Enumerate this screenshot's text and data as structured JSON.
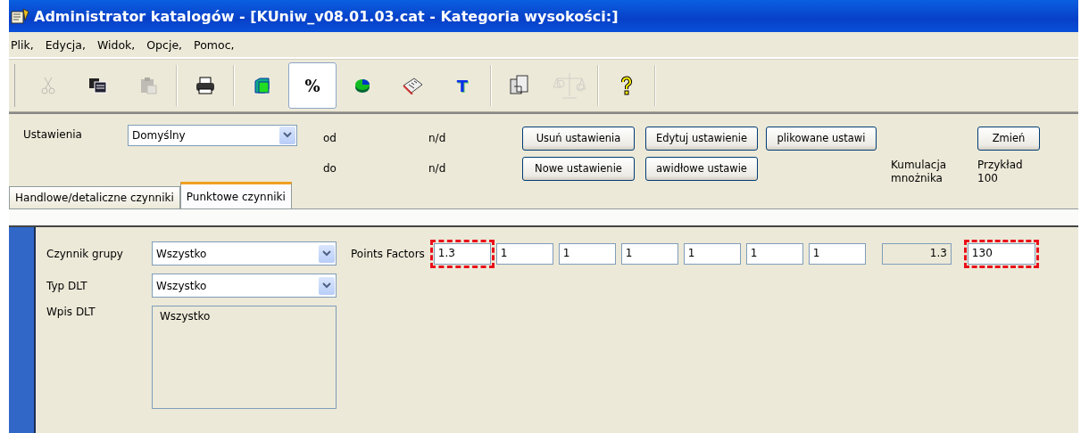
{
  "window": {
    "title": "Administrator katalogów - [KUniw_v08.01.03.cat - Kategoria wysokości:]"
  },
  "menu": [
    "Plik,",
    "Edycja,",
    "Widok,",
    "Opcje,",
    "Pomoc,"
  ],
  "toolbar": [
    [
      {
        "disabled": true,
        "selected": false
      },
      {
        "disabled": false,
        "selected": false
      },
      {
        "disabled": true,
        "selected": false
      }
    ],
    [
      {
        "disabled": false,
        "selected": false
      }
    ],
    [
      {
        "disabled": false,
        "selected": false
      },
      {
        "disabled": false,
        "selected": true,
        "label": "%"
      },
      {
        "disabled": false,
        "selected": false
      },
      {
        "disabled": false,
        "selected": false
      },
      {
        "disabled": false,
        "selected": false,
        "label": "T"
      }
    ],
    [
      {
        "disabled": false,
        "selected": false
      },
      {
        "disabled": true,
        "selected": false
      }
    ],
    [
      {
        "disabled": false,
        "selected": false
      }
    ]
  ],
  "settings": {
    "label": "Ustawienia",
    "value": "Domyślny",
    "from_label": "od",
    "from_value": "n/d",
    "to_label": "do",
    "to_value": "n/d",
    "buttons_row1": [
      "Usuń ustawienia",
      "Edytuj ustawienie",
      "plikowane ustawi"
    ],
    "buttons_row2": [
      "Nowe ustawienie",
      "awidłowe ustawie"
    ],
    "change_button": "Zmień",
    "cumulation_label": "Kumulacja mnożnika",
    "example_label": "Przykład",
    "example_value": "100"
  },
  "tabs": [
    {
      "label": "Handlowe/detaliczne czynniki",
      "selected": false
    },
    {
      "label": "Punktowe czynniki",
      "selected": true
    }
  ],
  "filters": [
    {
      "label": "Czynnik grupy",
      "value": "Wszystko"
    },
    {
      "label": "Typ DLT",
      "value": "Wszystko"
    }
  ],
  "dlt_entry": {
    "label": "Wpis DLT",
    "items": [
      "Wszystko"
    ],
    "disabled": true
  },
  "points_factors": {
    "label": "Points Factors",
    "fields": [
      {
        "value": "1.3",
        "highlighted": true
      },
      {
        "value": "1",
        "highlighted": false
      },
      {
        "value": "1",
        "highlighted": false
      },
      {
        "value": "1",
        "highlighted": false
      },
      {
        "value": "1",
        "highlighted": false
      },
      {
        "value": "1",
        "highlighted": false
      },
      {
        "value": "1",
        "highlighted": false
      }
    ],
    "cumulation": {
      "value": "1.3",
      "highlighted": false
    },
    "example": {
      "value": "130",
      "highlighted": true
    }
  }
}
